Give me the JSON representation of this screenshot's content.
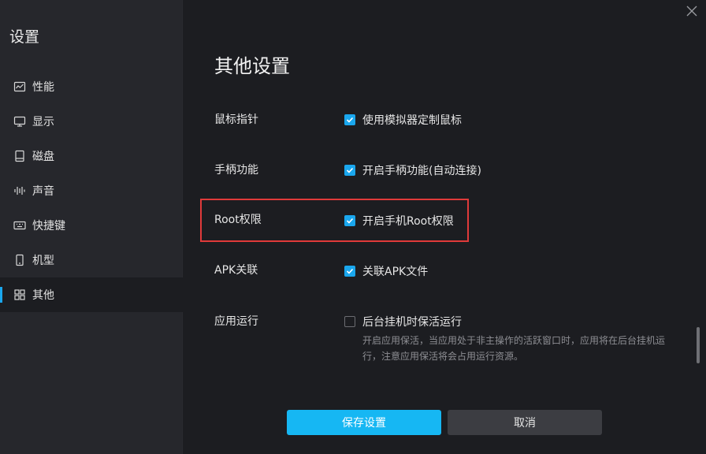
{
  "sidebar": {
    "title": "设置",
    "items": [
      {
        "label": "性能",
        "icon": "chart-icon"
      },
      {
        "label": "显示",
        "icon": "monitor-icon"
      },
      {
        "label": "磁盘",
        "icon": "disk-icon"
      },
      {
        "label": "声音",
        "icon": "sound-icon"
      },
      {
        "label": "快捷键",
        "icon": "keyboard-icon"
      },
      {
        "label": "机型",
        "icon": "phone-icon"
      },
      {
        "label": "其他",
        "icon": "grid-icon"
      }
    ],
    "active_index": 6
  },
  "main": {
    "title": "其他设置",
    "settings": [
      {
        "label": "鼠标指针",
        "option": "使用模拟器定制鼠标",
        "checked": true
      },
      {
        "label": "手柄功能",
        "option": "开启手柄功能(自动连接)",
        "checked": true
      },
      {
        "label": "Root权限",
        "option": "开启手机Root权限",
        "checked": true
      },
      {
        "label": "APK关联",
        "option": "关联APK文件",
        "checked": true
      },
      {
        "label": "应用运行",
        "option": "后台挂机时保活运行",
        "checked": false,
        "description": "开启应用保活，当应用处于非主操作的活跃窗口时，应用将在后台挂机运行，注意应用保活将会占用运行资源。"
      }
    ]
  },
  "buttons": {
    "save": "保存设置",
    "cancel": "取消"
  },
  "colors": {
    "accent": "#1aa7ee",
    "highlight": "#e03a3a",
    "background": "#1c1d21",
    "sidebar": "#26272c"
  }
}
